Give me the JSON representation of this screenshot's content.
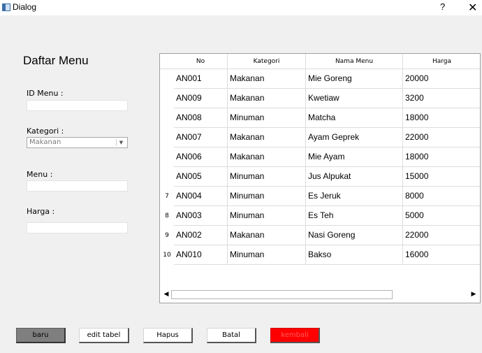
{
  "window": {
    "title": "Dialog",
    "help_label": "?",
    "close_label": "✕"
  },
  "form": {
    "heading": "Daftar Menu",
    "id_label": "ID Menu :",
    "id_value": "",
    "kategori_label": "Kategori :",
    "kategori_value": "Makanan",
    "menu_label": "Menu :",
    "menu_value": "",
    "harga_label": "Harga :",
    "harga_value": ""
  },
  "table": {
    "headers": [
      "No",
      "Kategori",
      "Nama Menu",
      "Harga"
    ],
    "rows": [
      {
        "row_num": "",
        "id": "AN001",
        "kategori": "Makanan",
        "nama": "Mie Goreng",
        "harga": "20000"
      },
      {
        "row_num": "",
        "id": "AN009",
        "kategori": "Makanan",
        "nama": "Kwetiaw",
        "harga": "3200"
      },
      {
        "row_num": "",
        "id": "AN008",
        "kategori": "Minuman",
        "nama": "Matcha",
        "harga": "18000"
      },
      {
        "row_num": "",
        "id": "AN007",
        "kategori": "Makanan",
        "nama": "Ayam Geprek",
        "harga": "22000"
      },
      {
        "row_num": "",
        "id": "AN006",
        "kategori": "Makanan",
        "nama": "Mie Ayam",
        "harga": "18000"
      },
      {
        "row_num": "",
        "id": "AN005",
        "kategori": "Minuman",
        "nama": "Jus Alpukat",
        "harga": "15000"
      },
      {
        "row_num": "7",
        "id": "AN004",
        "kategori": "Minuman",
        "nama": "Es Jeruk",
        "harga": "8000"
      },
      {
        "row_num": "8",
        "id": "AN003",
        "kategori": "Minuman",
        "nama": "Es Teh",
        "harga": "5000"
      },
      {
        "row_num": "9",
        "id": "AN002",
        "kategori": "Makanan",
        "nama": "Nasi Goreng",
        "harga": "22000"
      },
      {
        "row_num": "10",
        "id": "AN010",
        "kategori": "Minuman",
        "nama": "Bakso",
        "harga": "16000"
      }
    ]
  },
  "buttons": {
    "baru": "baru",
    "edit": "edit tabel",
    "hapus": "Hapus",
    "batal": "Batal",
    "kembali": "kembali"
  },
  "colors": {
    "kembali_bg": "#ff0000",
    "baru_bg": "#7f7f7f"
  }
}
